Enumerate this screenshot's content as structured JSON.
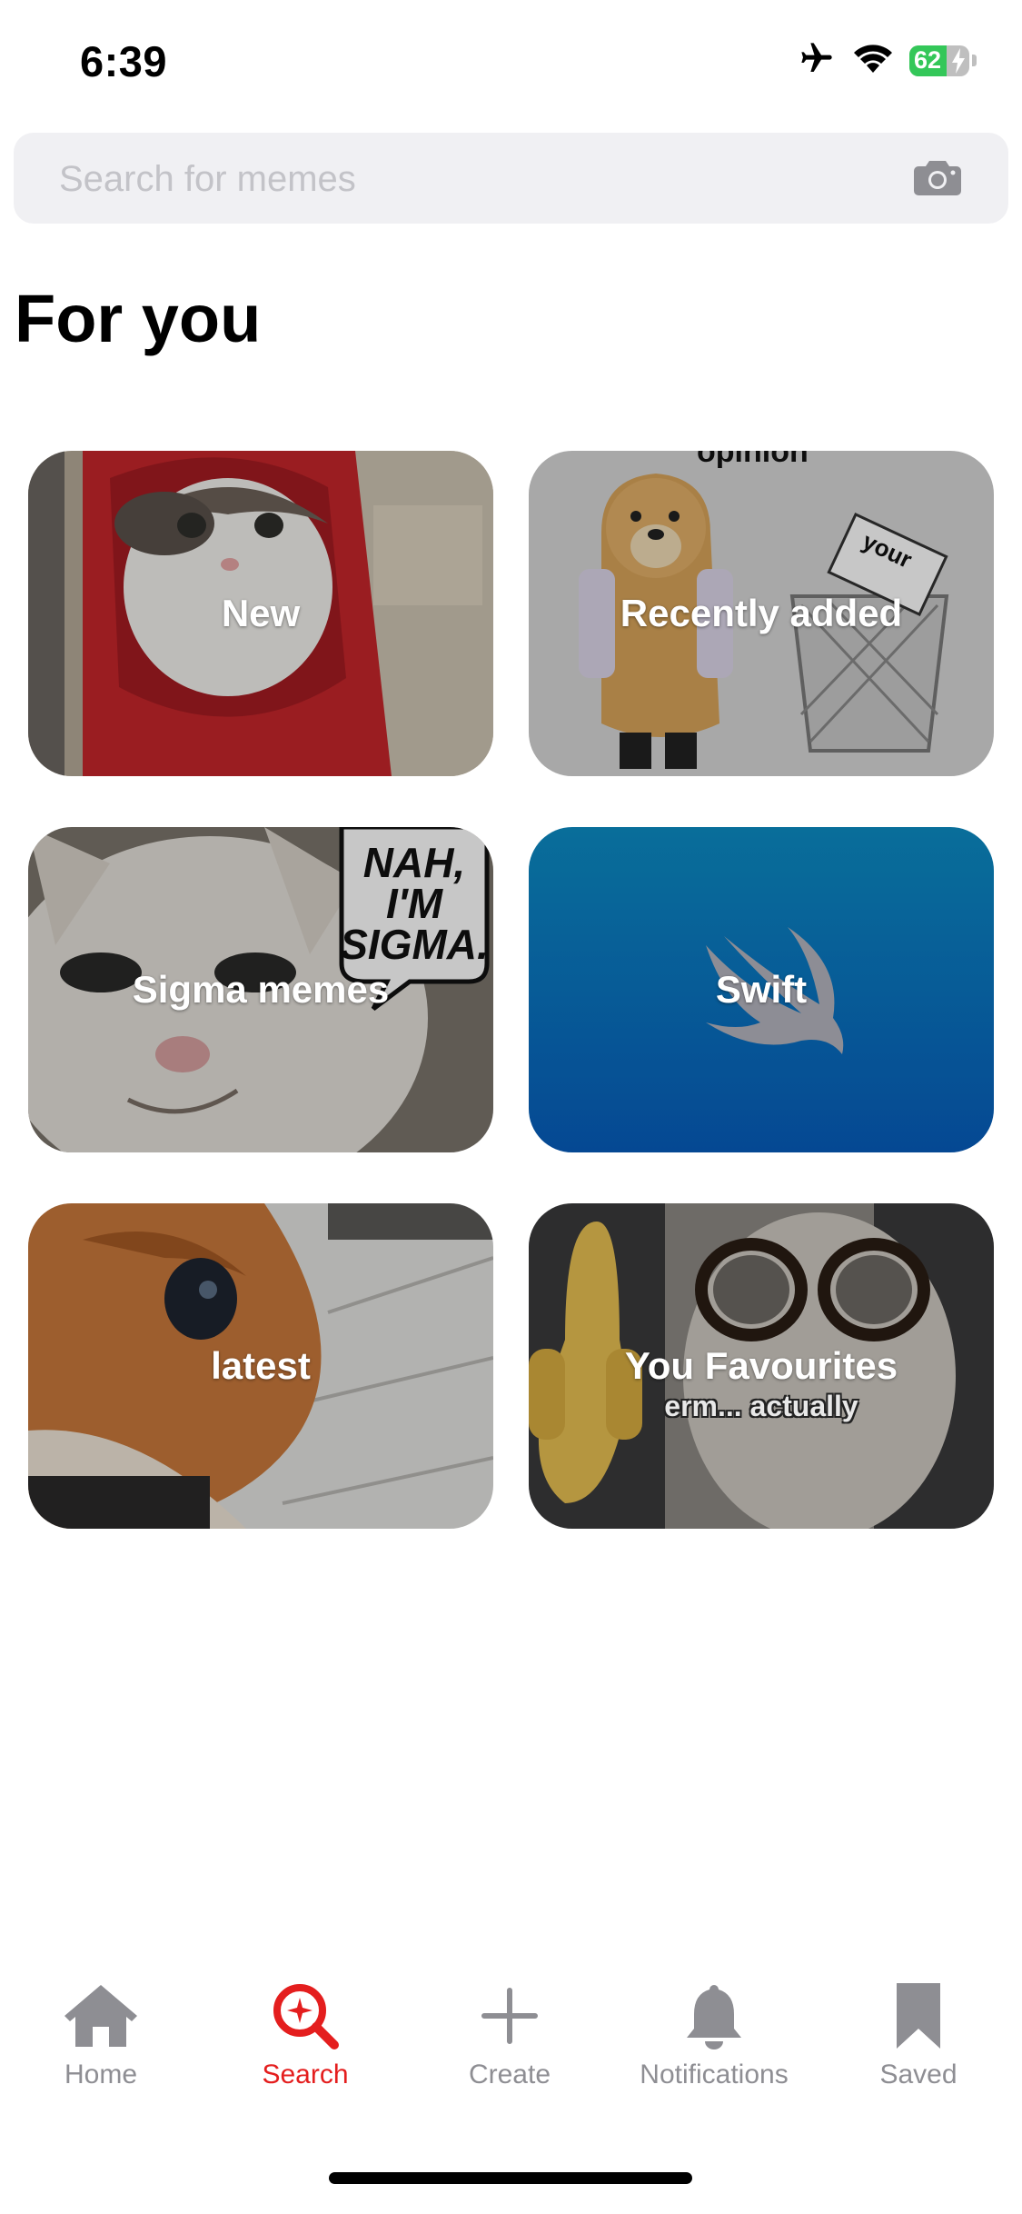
{
  "status_bar": {
    "time": "6:39",
    "battery_percent": "62",
    "icons": [
      "airplane-icon",
      "wifi-icon",
      "battery-icon"
    ]
  },
  "search": {
    "placeholder": "Search for memes",
    "value": "",
    "icon": "camera-icon"
  },
  "section_title": "For you",
  "cards": [
    {
      "label": "New",
      "image": "cat in red hoodie"
    },
    {
      "label": "Recently added",
      "image": "doge next to trash bin"
    },
    {
      "label": "Sigma memes",
      "image": "smirking cat with speech bubble"
    },
    {
      "label": "Swift",
      "image": "swift bird logo on blue"
    },
    {
      "label": "latest",
      "image": "close-up orange cat"
    },
    {
      "label": "You Favourites",
      "sublabel": "erm... actually",
      "image": "cat with glasses raising finger"
    }
  ],
  "sticker_text": {
    "opinion": "opinion",
    "your": "your",
    "sigma": "NAH, I'M SIGMA."
  },
  "tabs": [
    {
      "label": "Home",
      "icon": "home-icon",
      "active": false
    },
    {
      "label": "Search",
      "icon": "search-icon",
      "active": true
    },
    {
      "label": "Create",
      "icon": "plus-icon",
      "active": false
    },
    {
      "label": "Notifications",
      "icon": "bell-icon",
      "active": false
    },
    {
      "label": "Saved",
      "icon": "bookmark-icon",
      "active": false
    }
  ],
  "colors": {
    "accent": "#e41e1e",
    "inactive_tab": "#8e8e93",
    "search_bg": "#f0f0f3",
    "battery_green": "#34c759"
  }
}
